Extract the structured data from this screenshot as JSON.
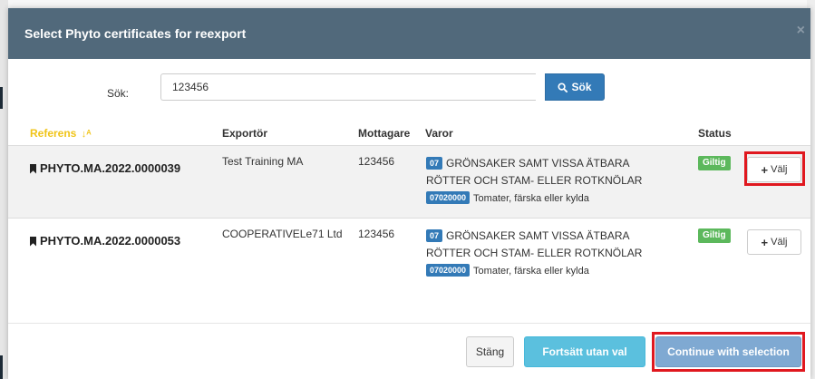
{
  "modal": {
    "title": "Select Phyto certificates for reexport",
    "close_label": "×"
  },
  "search": {
    "label": "Sök:",
    "value": "123456",
    "button_label": "Sök"
  },
  "table": {
    "headers": {
      "referens": "Referens",
      "exportor": "Exportör",
      "mottagare": "Mottagare",
      "varor": "Varor",
      "status": "Status"
    },
    "rows": [
      {
        "referens": "PHYTO.MA.2022.0000039",
        "exportor": "Test Training MA",
        "mottagare": "123456",
        "varor_badge": "07",
        "varor_text": "GRÖNSAKER SAMT VISSA ÄTBARA",
        "varor_text2": "RÖTTER OCH STAM- ELLER ROTKNÖLAR",
        "varor_code": "07020000",
        "varor_sub": "Tomater, färska eller kylda",
        "status": "Giltig",
        "action": "Välj"
      },
      {
        "referens": "PHYTO.MA.2022.0000053",
        "exportor": "COOPERATIVELe71 Ltd",
        "mottagare": "123456",
        "varor_badge": "07",
        "varor_text": "GRÖNSAKER SAMT VISSA ÄTBARA",
        "varor_text2": "RÖTTER OCH STAM- ELLER ROTKNÖLAR",
        "varor_code": "07020000",
        "varor_sub": "Tomater, färska eller kylda",
        "status": "Giltig",
        "action": "Välj"
      }
    ]
  },
  "footer": {
    "close_label": "Stäng",
    "continue_without_label": "Fortsätt utan val",
    "continue_with_label": "Continue with selection"
  },
  "colors": {
    "header_bg": "#51697b",
    "primary": "#337ab7",
    "info": "#5bc0de",
    "success": "#5cb85c",
    "highlight": "#e0181f",
    "sort_accent": "#f0c419"
  }
}
